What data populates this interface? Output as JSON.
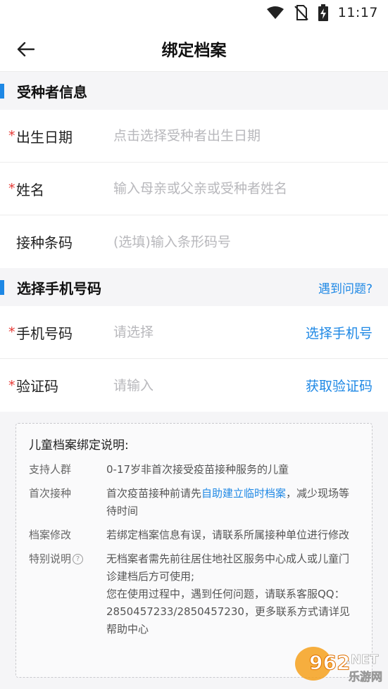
{
  "status_bar": {
    "time": "11:17",
    "icons": [
      "wifi-icon",
      "no-sim-icon",
      "battery-charging-icon"
    ]
  },
  "header": {
    "back_icon": "arrow-left-icon",
    "title": "绑定档案"
  },
  "recipient_section": {
    "title": "受种者信息",
    "rows": [
      {
        "required": "*",
        "label": "出生日期",
        "placeholder": "点击选择受种者出生日期"
      },
      {
        "required": "*",
        "label": "姓名",
        "placeholder": "输入母亲或父亲或受种者姓名"
      },
      {
        "required": "",
        "label": "接种条码",
        "placeholder": "(选填)输入条形码号"
      }
    ]
  },
  "phone_section": {
    "title": "选择手机号码",
    "help_link": "遇到问题?",
    "rows": [
      {
        "required": "*",
        "label": "手机号码",
        "placeholder": "请选择",
        "action": "选择手机号"
      },
      {
        "required": "*",
        "label": "验证码",
        "placeholder": "请输入",
        "action": "获取验证码"
      }
    ]
  },
  "info": {
    "title": "儿童档案绑定说明:",
    "items": [
      {
        "key": "支持人群",
        "value": "0-17岁非首次接受疫苗接种服务的儿童"
      },
      {
        "key": "首次接种",
        "value_before": "首次疫苗接种前请先",
        "value_link": "自助建立临时档案",
        "value_after": "，减少现场等待时间"
      },
      {
        "key": "档案修改",
        "value": "若绑定档案信息有误，请联系所属接种单位进行修改"
      },
      {
        "key": "特别说明",
        "icon": "question-circle-icon",
        "lines": [
          "无档案者需先前往居住地社区服务中心成人或儿童门诊建档后方可使用;",
          "您在使用过程中，遇到任何问题，请联系客服QQ：2850457233/2850457230，更多联系方式请详见帮助中心"
        ]
      }
    ]
  },
  "watermark": {
    "number": "962",
    "suffix": ".NET",
    "subtitle": "乐游网"
  },
  "colors": {
    "accent": "#1e88e5",
    "required": "#e53935",
    "background": "#f5f5f7"
  }
}
